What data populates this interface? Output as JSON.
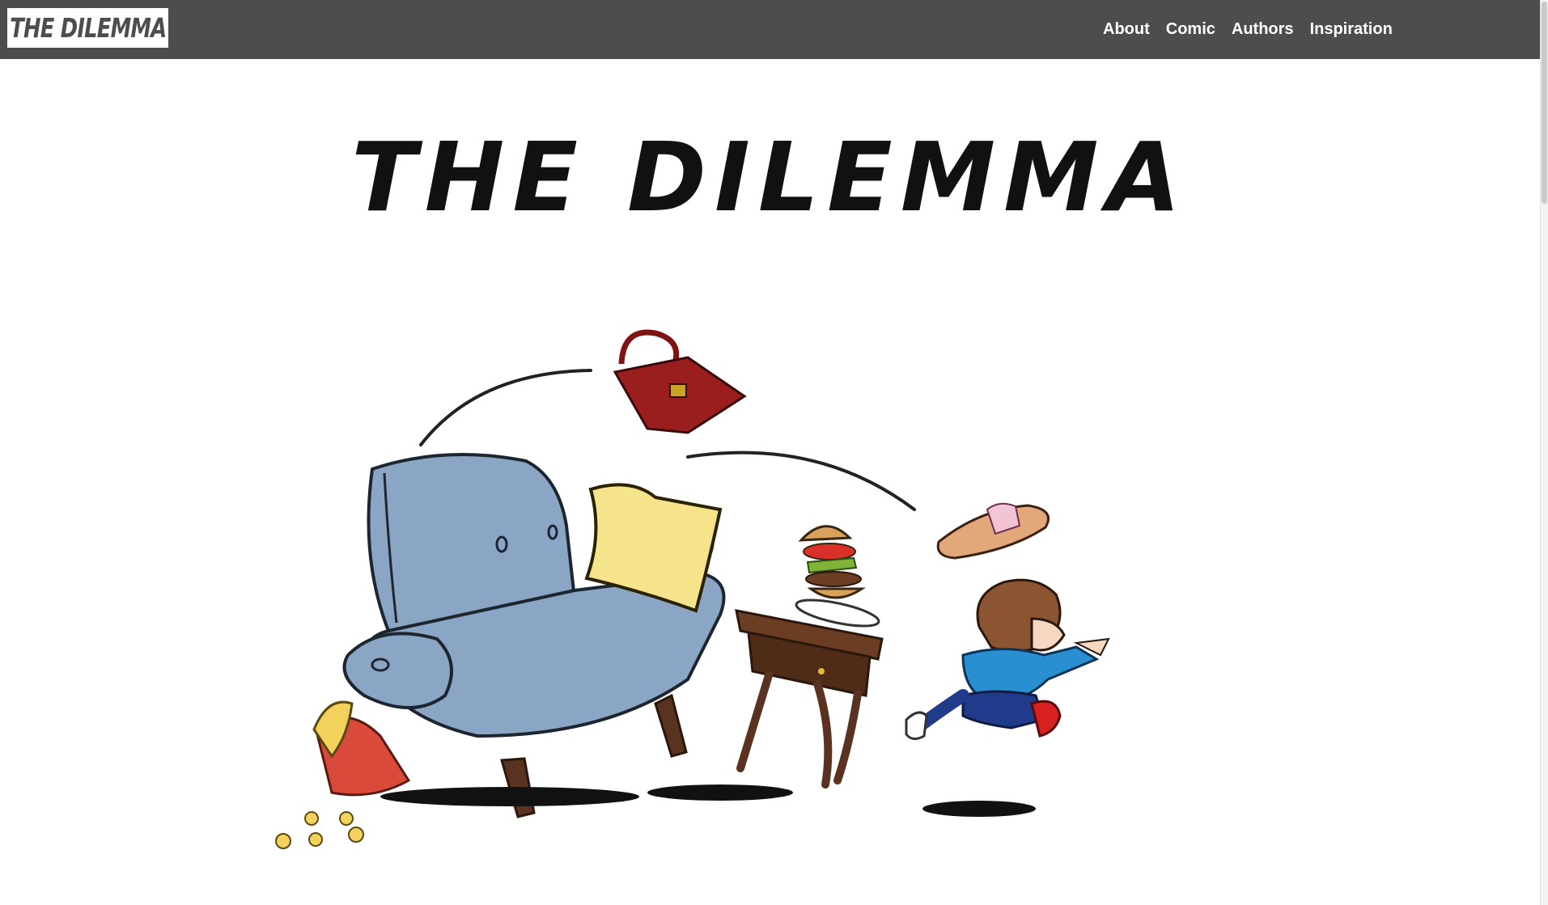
{
  "navbar": {
    "logo_text": "THE DILEMMA",
    "links": [
      {
        "label": "About"
      },
      {
        "label": "Comic"
      },
      {
        "label": "Authors"
      },
      {
        "label": "Inspiration"
      }
    ]
  },
  "hero": {
    "title": "THE DILEMMA",
    "illustration": "cartoon-boy-running-from-flying-household-items"
  },
  "colors": {
    "navbar_bg": "#4d4d4d",
    "armchair": "#8aa6c4",
    "pillow": "#f6e48d",
    "handbag": "#9b1e1e",
    "table": "#5a3320",
    "hoodie": "#2a8fd1"
  }
}
